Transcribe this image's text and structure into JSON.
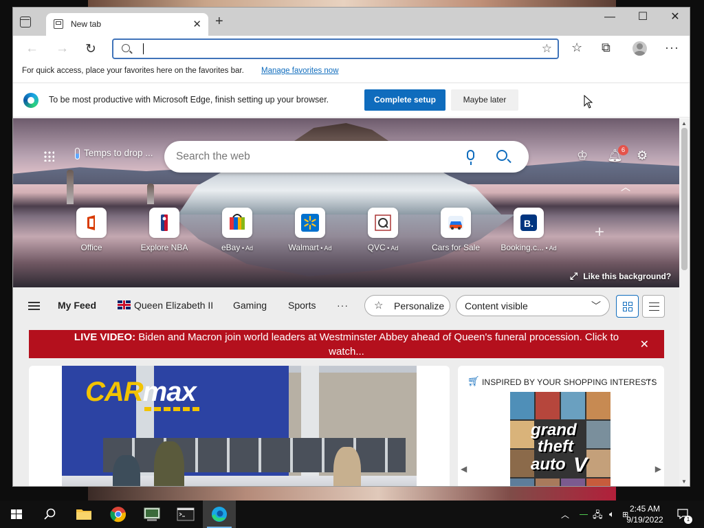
{
  "browser": {
    "tab": {
      "title": "New tab"
    },
    "address_bar": {
      "value": "",
      "placeholder": ""
    },
    "favorites_bar": {
      "text": "For quick access, place your favorites here on the favorites bar.",
      "link": "Manage favorites now"
    },
    "setup_banner": {
      "text": "To be most productive with Microsoft Edge, finish setting up your browser.",
      "primary_button": "Complete setup",
      "secondary_button": "Maybe later"
    }
  },
  "newtab": {
    "weather": "Temps to drop ...",
    "search_placeholder": "Search the web",
    "notification_count": "6",
    "quick_links": [
      {
        "label": "Office",
        "ad": "",
        "icon": "office-icon"
      },
      {
        "label": "Explore NBA",
        "ad": "",
        "icon": "nba-icon"
      },
      {
        "label": "eBay",
        "ad": " • Ad",
        "icon": "ebay-icon"
      },
      {
        "label": "Walmart",
        "ad": " • Ad",
        "icon": "walmart-icon"
      },
      {
        "label": "QVC",
        "ad": " • Ad",
        "icon": "qvc-icon"
      },
      {
        "label": "Cars for Sale",
        "ad": "",
        "icon": "car-icon"
      },
      {
        "label": "Booking.c...",
        "ad": " • Ad",
        "icon": "booking-icon"
      }
    ],
    "like_background": "Like this background?",
    "feed_tabs": [
      "My Feed",
      "Queen Elizabeth II",
      "Gaming",
      "Sports"
    ],
    "feed_more": "···",
    "personalize": "Personalize",
    "content_visibility": "Content visible",
    "live_banner": {
      "label": "LIVE VIDEO:",
      "text": "Biden and Macron join world leaders at Westminster Abbey ahead of Queen's funeral procession. Click to watch..."
    },
    "shopping_card": {
      "header": "INSPIRED BY YOUR SHOPPING INTERESTS",
      "more": "···",
      "product_title_words": [
        "grand",
        "theft",
        "auto",
        "V"
      ]
    },
    "news_card": {
      "sign_text_yellow": "CAR",
      "sign_text_white": "max"
    }
  },
  "taskbar": {
    "time": "2:45 AM",
    "date": "9/19/2022",
    "notification_count": "1"
  },
  "colors": {
    "accent": "#0f6cbd",
    "live_banner": "#b4101d",
    "notif_badge": "#e5534b"
  }
}
